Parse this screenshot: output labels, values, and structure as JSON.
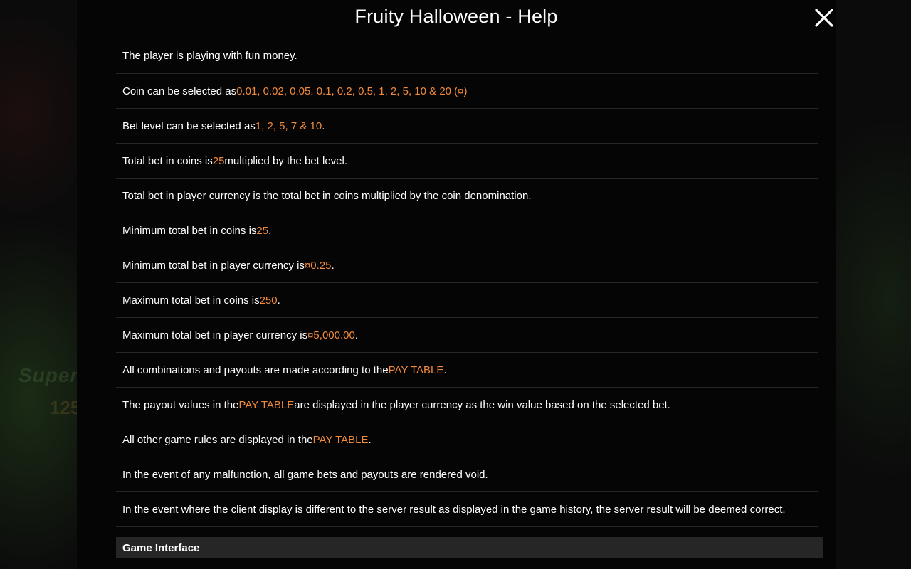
{
  "header": {
    "title": "Fruity Halloween - Help",
    "close_icon": "close-icon"
  },
  "background": {
    "text_fragment": "Super",
    "number_fragment": "125"
  },
  "rules": [
    {
      "parts": [
        "The player is playing with fun money."
      ]
    },
    {
      "parts": [
        "Coin can be selected as ",
        "0.01, 0.02, 0.05, 0.1, 0.2, 0.5, 1, 2, 5, 10 & 20 (¤)",
        ""
      ]
    },
    {
      "parts": [
        "Bet level can be selected as ",
        "1, 2, 5, 7 & 10",
        "."
      ]
    },
    {
      "parts": [
        "Total bet in coins is ",
        "25",
        " multiplied by the bet level."
      ]
    },
    {
      "parts": [
        "Total bet in player currency is the total bet in coins multiplied by the coin denomination."
      ]
    },
    {
      "parts": [
        "Minimum total bet in coins is ",
        "25",
        "."
      ]
    },
    {
      "parts": [
        "Minimum total bet in player currency is ",
        "¤0.25",
        "."
      ]
    },
    {
      "parts": [
        "Maximum total bet in coins is ",
        "250",
        "."
      ]
    },
    {
      "parts": [
        "Maximum total bet in player currency is ",
        "¤5,000.00",
        "."
      ]
    },
    {
      "parts": [
        "All combinations and payouts are made according to the ",
        "PAY TABLE",
        "."
      ]
    },
    {
      "parts": [
        "The payout values in the ",
        "PAY TABLE",
        " are displayed in the player currency as the win value based on the selected bet."
      ]
    },
    {
      "parts": [
        "All other game rules are displayed in the ",
        "PAY TABLE",
        "."
      ]
    },
    {
      "parts": [
        "In the event of any malfunction, all game bets and payouts are rendered void."
      ]
    },
    {
      "parts": [
        "In the event where the client display is different to the server result as displayed in the game history, the server result will be deemed correct."
      ]
    }
  ],
  "sections": {
    "game_interface": "Game Interface"
  },
  "colors": {
    "highlight": "#f28a3c",
    "panel_background": "#050505",
    "section_background": "#262626",
    "divider": "#262626"
  }
}
